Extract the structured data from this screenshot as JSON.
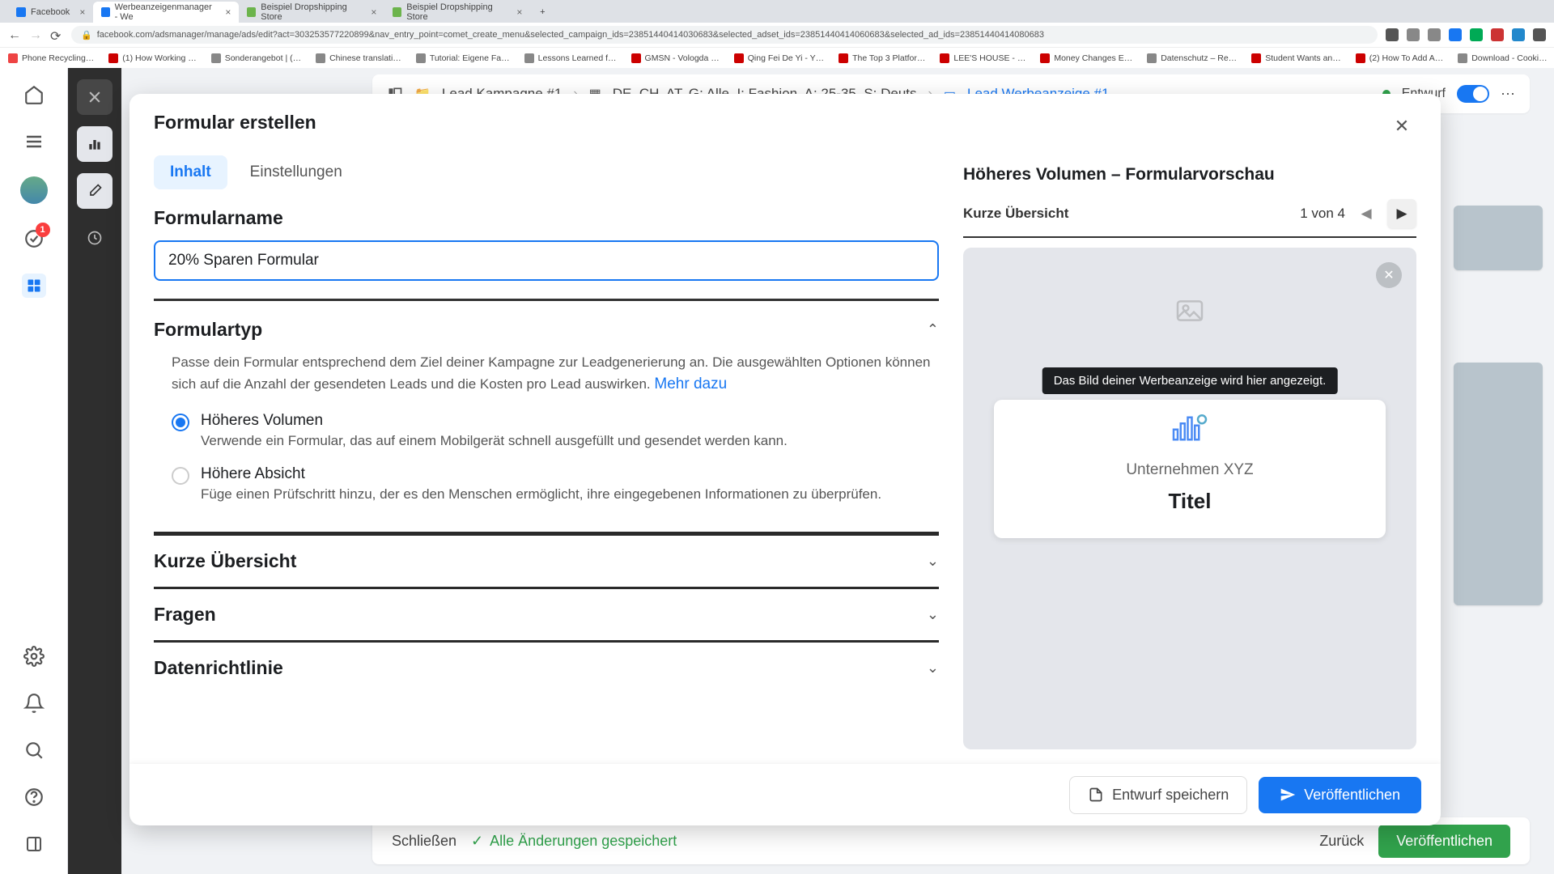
{
  "browser": {
    "tabs": [
      {
        "label": "Facebook",
        "fav": "#1877f2"
      },
      {
        "label": "Werbeanzeigenmanager - We",
        "fav": "#1877f2",
        "active": true
      },
      {
        "label": "Beispiel Dropshipping Store",
        "fav": "#6cb44c"
      },
      {
        "label": "Beispiel Dropshipping Store",
        "fav": "#6cb44c"
      }
    ],
    "url": "facebook.com/adsmanager/manage/ads/edit?act=303253577220899&nav_entry_point=comet_create_menu&selected_campaign_ids=23851440414030683&selected_adset_ids=23851440414060683&selected_ad_ids=23851440414080683",
    "bookmarks": [
      "Phone Recycling…",
      "(1) How Working …",
      "Sonderangebot | (…",
      "Chinese translati…",
      "Tutorial: Eigene Fa…",
      "Lessons Learned f…",
      "GMSN - Vologda …",
      "Qing Fei De Yi - Y…",
      "The Top 3 Platfor…",
      "LEE'S HOUSE - …",
      "Money Changes E…",
      "Datenschutz – Re…",
      "Student Wants an…",
      "(2) How To Add A…",
      "Download - Cooki…"
    ]
  },
  "crumbs": {
    "campaign": "Lead Kampagne #1",
    "adset": "DE, CH, AT, G: Alle, I: Fashion, A: 25-35, S: Deuts",
    "ad": "Lead Werbeanzeige #1",
    "status": "Entwurf"
  },
  "notif_badge": "1",
  "bottom": {
    "close": "Schließen",
    "saved": "Alle Änderungen gespeichert",
    "back": "Zurück",
    "publish": "Veröffentlichen"
  },
  "modal": {
    "title": "Formular erstellen",
    "tabs": {
      "content": "Inhalt",
      "settings": "Einstellungen"
    },
    "name_section": "Formularname",
    "name_value": "20% Sparen Formular",
    "type_section": "Formulartyp",
    "type_desc": "Passe dein Formular entsprechend dem Ziel deiner Kampagne zur Leadgenerierung an. Die ausgewählten Optionen können sich auf die Anzahl der gesendeten Leads und die Kosten pro Lead auswirken.",
    "type_more": "Mehr dazu",
    "opt1": {
      "title": "Höheres Volumen",
      "desc": "Verwende ein Formular, das auf einem Mobilgerät schnell ausgefüllt und gesendet werden kann."
    },
    "opt2": {
      "title": "Höhere Absicht",
      "desc": "Füge einen Prüfschritt hinzu, der es den Menschen ermöglicht, ihre eingegebenen Informationen zu überprüfen."
    },
    "sec_overview": "Kurze Übersicht",
    "sec_questions": "Fragen",
    "sec_privacy": "Datenrichtlinie",
    "preview": {
      "title": "Höheres Volumen – Formularvorschau",
      "step_label": "Kurze Übersicht",
      "step_pos": "1 von 4",
      "tip": "Das Bild deiner Werbeanzeige wird hier angezeigt.",
      "company": "Unternehmen XYZ",
      "card_title": "Titel"
    },
    "footer": {
      "draft": "Entwurf speichern",
      "publish": "Veröffentlichen"
    }
  }
}
